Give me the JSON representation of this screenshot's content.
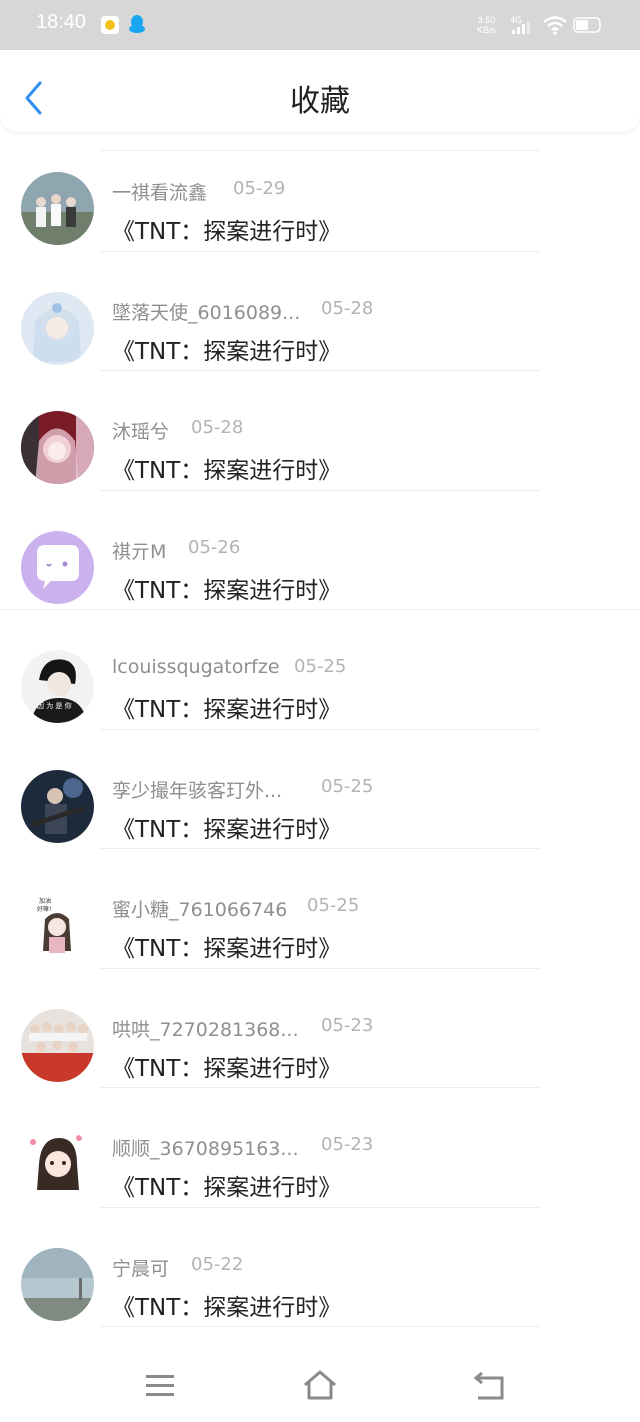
{
  "status_bar": {
    "time": "18:40",
    "net_speed_value": "3.50",
    "net_speed_unit": "KB/s",
    "network": "4G",
    "icons": [
      "app-notification-icon",
      "qq-icon",
      "signal-icon",
      "wifi-icon",
      "battery-icon"
    ]
  },
  "header": {
    "title": "收藏",
    "back_icon": "chevron-left-icon",
    "accent_color": "#2f8ef0"
  },
  "favorites": [
    {
      "user": "一祺看流鑫",
      "date": "05-29",
      "title": "《TNT：探案进行时》"
    },
    {
      "user": "墜落天使_6016089...",
      "date": "05-28",
      "title": "《TNT：探案进行时》"
    },
    {
      "user": "沐瑶兮",
      "date": "05-28",
      "title": "《TNT：探案进行时》"
    },
    {
      "user": "祺亓M",
      "date": "05-26",
      "title": "《TNT：探案进行时》"
    },
    {
      "user": "lcouissqugatorfze",
      "date": "05-25",
      "title": "《TNT：探案进行时》"
    },
    {
      "user": "孪少撮年骇客玎外...",
      "date": "05-25",
      "title": "《TNT：探案进行时》"
    },
    {
      "user": "蜜小糖_761066746",
      "date": "05-25",
      "title": "《TNT：探案进行时》"
    },
    {
      "user": "哄哄_7270281368...",
      "date": "05-23",
      "title": "《TNT：探案进行时》"
    },
    {
      "user": "顺顺_3670895163...",
      "date": "05-23",
      "title": "《TNT：探案进行时》"
    },
    {
      "user": "宁晨可",
      "date": "05-22",
      "title": "《TNT：探案进行时》"
    }
  ],
  "bottom_nav": {
    "icons": [
      "menu-icon",
      "home-icon",
      "return-icon"
    ]
  }
}
